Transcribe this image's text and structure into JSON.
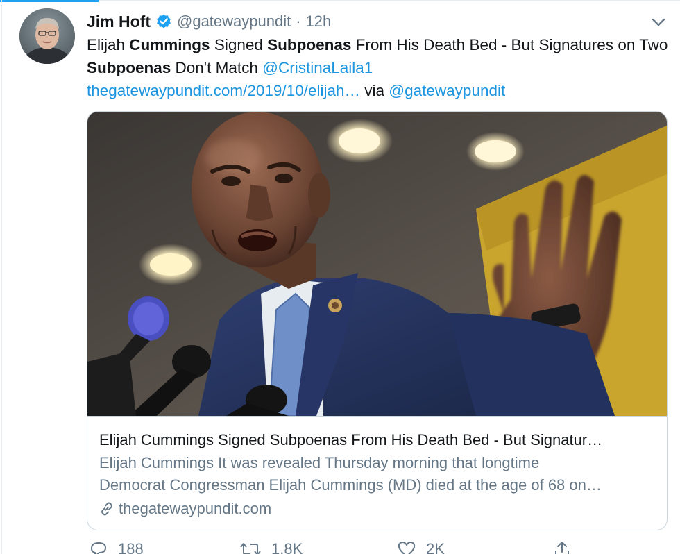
{
  "tweet": {
    "author": {
      "name": "Jim Hoft",
      "handle": "@gatewaypundit",
      "verified": true,
      "avatar_icon": "profile-photo"
    },
    "time": "12h",
    "separator": "·",
    "text": {
      "part1": "Elijah ",
      "bold1": "Cummings",
      "part2": " Signed ",
      "bold2": "Subpoenas",
      "part3": " From His Death Bed - But Signatures on Two ",
      "bold3": "Subpoenas",
      "part4": " Don't Match ",
      "mention1": "@CristinaLaila1",
      "url": "thegatewaypundit.com/2019/10/elijah…",
      "via": " via ",
      "mention2": "@gatewaypundit"
    },
    "card": {
      "title": "Elijah Cummings Signed Subpoenas From His Death Bed - But Signatur…",
      "description_line1": "Elijah Cummings It was revealed Thursday morning that longtime",
      "description_line2": "Democrat Congressman Elijah Cummings (MD) died at the age of 68 on…",
      "domain": "thegatewaypundit.com",
      "image_alt": "Photo of a man speaking at a podium with his hand raised"
    },
    "actions": {
      "reply_count": "188",
      "retweet_count": "1.8K",
      "like_count": "2K"
    }
  },
  "colors": {
    "accent": "#1da1f2",
    "link": "#1b95e0",
    "text": "#14171a",
    "muted": "#657786",
    "border": "#ccd6dd"
  },
  "icons": [
    "verified-badge-icon",
    "chevron-down-icon",
    "link-icon",
    "reply-icon",
    "retweet-icon",
    "like-icon",
    "share-icon"
  ]
}
